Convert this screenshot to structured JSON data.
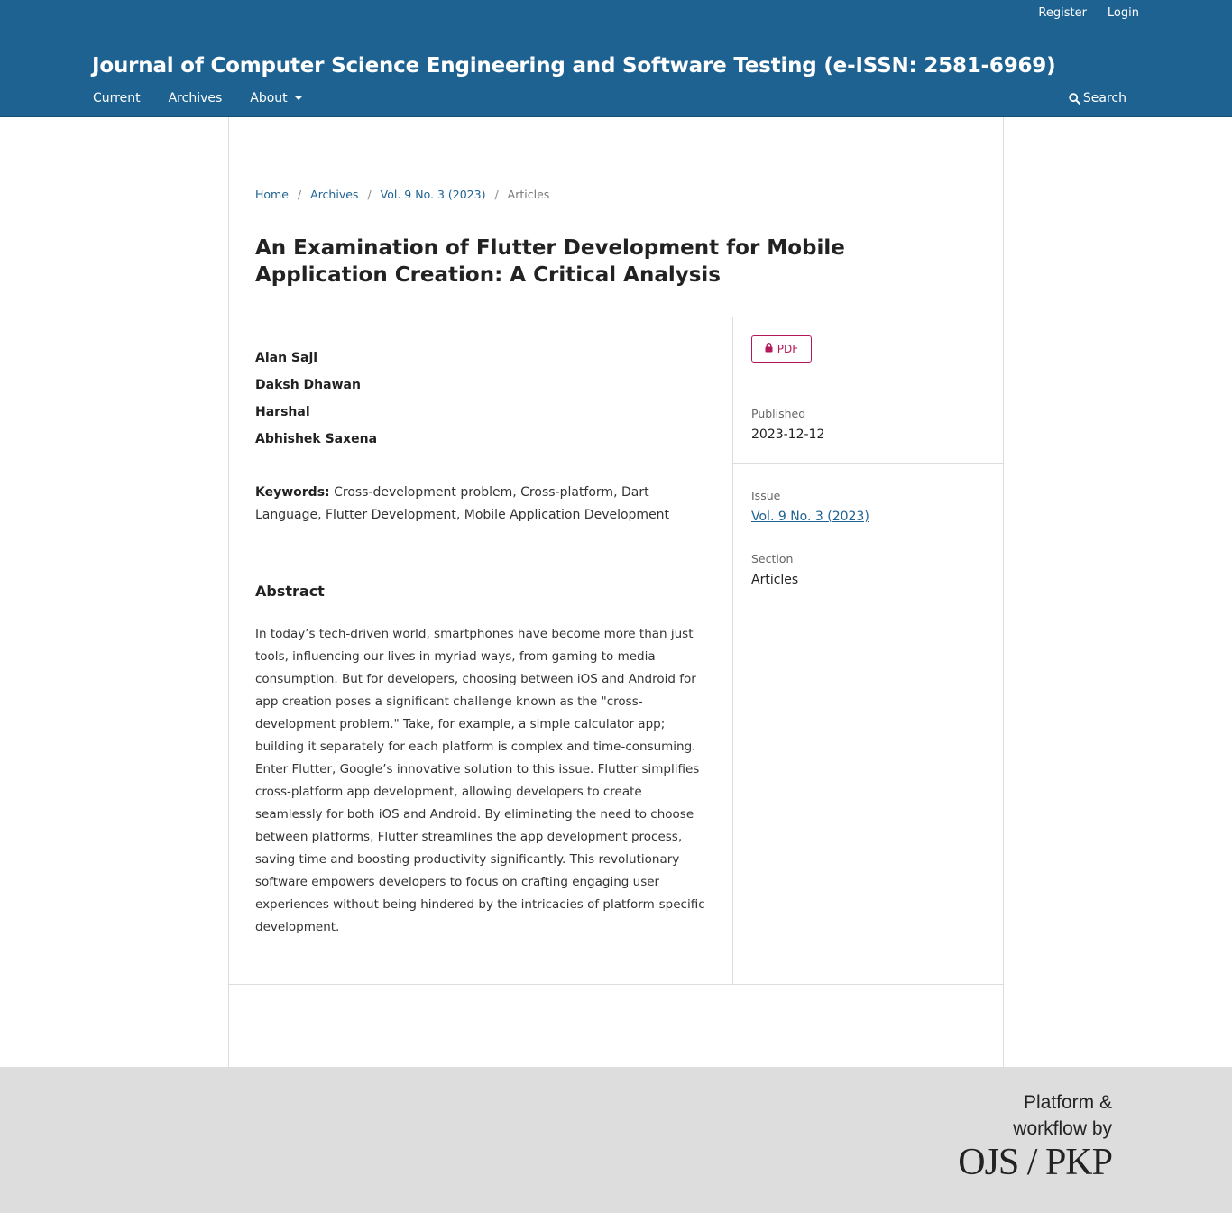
{
  "header": {
    "register_label": "Register",
    "login_label": "Login",
    "site_title": "Journal of Computer Science Engineering and Software Testing (e-ISSN: 2581-6969)",
    "nav": {
      "current": "Current",
      "archives": "Archives",
      "about": "About"
    },
    "search_label": "Search"
  },
  "breadcrumb": {
    "home": "Home",
    "archives": "Archives",
    "issue": "Vol. 9 No. 3 (2023)",
    "current": "Articles",
    "separator": "/"
  },
  "article": {
    "title": "An Examination of Flutter Development for Mobile Application Creation: A Critical Analysis",
    "authors": [
      "Alan Saji",
      "Daksh Dhawan",
      "Harshal",
      "Abhishek Saxena"
    ],
    "keywords_label": "Keywords:",
    "keywords": "Cross-development problem, Cross-platform, Dart Language, Flutter Development, Mobile Application Development",
    "abstract_heading": "Abstract",
    "abstract": "In today’s tech-driven world, smartphones have become more than just tools, influencing our lives in myriad ways, from gaming to media consumption. But for developers, choosing between iOS and Android for app creation poses a significant challenge known as the \"cross-development problem.\" Take, for example, a simple calculator app; building it separately for each platform is complex and time-consuming. Enter Flutter, Google’s innovative solution to this issue. Flutter simplifies cross-platform app development, allowing developers to create seamlessly for both iOS and Android. By eliminating the need to choose between platforms, Flutter streamlines the app development process, saving time and boosting productivity significantly. This revolutionary software empowers developers to focus on crafting engaging user experiences without being hindered by the intricacies of platform-specific development."
  },
  "sidebar": {
    "pdf_label": "PDF",
    "published_label": "Published",
    "published_value": "2023-12-12",
    "issue_label": "Issue",
    "issue_value": "Vol. 9 No. 3 (2023)",
    "section_label": "Section",
    "section_value": "Articles"
  },
  "footer": {
    "line1": "Platform &",
    "line2": "workflow by",
    "logo_text": "OJS / PKP"
  },
  "colors": {
    "header_bg": "#1e6292",
    "link": "#1e6292",
    "pdf_accent": "#b3195a",
    "footer_bg": "#dddddd"
  },
  "icons": {
    "search": "search-icon",
    "about_caret": "caret-down-icon",
    "pdf_lock": "lock-icon"
  }
}
